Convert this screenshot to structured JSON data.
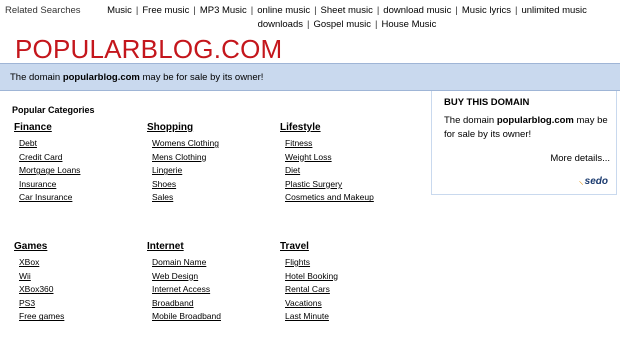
{
  "related": {
    "label": "Related Searches",
    "links": [
      "Music",
      "Free music",
      "MP3 Music",
      "online music",
      "Sheet music",
      "download music",
      "Music lyrics",
      "unlimited music downloads",
      "Gospel music",
      "House Music"
    ],
    "separator": "|"
  },
  "site_title": "POPULARBLOG.COM",
  "sale_bar": {
    "prefix": "The domain",
    "domain": "popularblog.com",
    "suffix": "may be for sale by its owner!"
  },
  "buy_box": {
    "title": "BUY THIS DOMAIN",
    "prefix": "The domain",
    "domain": "popularblog.com",
    "suffix": "may be for sale by its owner!",
    "more": "More details...",
    "logo": "sedo"
  },
  "popular_heading": "Popular Categories",
  "categories": [
    {
      "title": "Finance",
      "items": [
        "Debt",
        "Credit Card",
        "Mortgage Loans",
        "Insurance",
        "Car Insurance"
      ]
    },
    {
      "title": "Shopping",
      "items": [
        "Womens Clothing",
        "Mens Clothing",
        "Lingerie",
        "Shoes",
        "Sales"
      ]
    },
    {
      "title": "Lifestyle",
      "items": [
        "Fitness",
        "Weight Loss",
        "Diet",
        "Plastic Surgery",
        "Cosmetics and Makeup"
      ]
    },
    {
      "title": "Games",
      "items": [
        "XBox",
        "Wii",
        "XBox360",
        "PS3",
        "Free games"
      ]
    },
    {
      "title": "Internet",
      "items": [
        "Domain Name",
        "Web Design",
        "Internet Access",
        "Broadband",
        "Mobile Broadband"
      ]
    },
    {
      "title": "Travel",
      "items": [
        "Flights",
        "Hotel Booking",
        "Rental Cars",
        "Vacations",
        "Last Minute"
      ]
    }
  ]
}
